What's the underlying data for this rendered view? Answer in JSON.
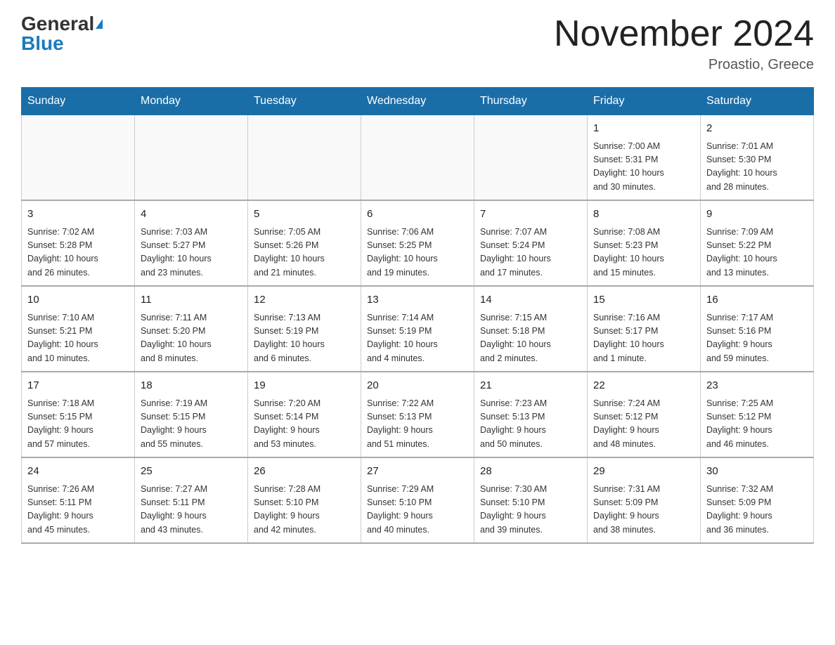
{
  "header": {
    "logo_general": "General",
    "logo_blue": "Blue",
    "month_title": "November 2024",
    "location": "Proastio, Greece"
  },
  "weekdays": [
    "Sunday",
    "Monday",
    "Tuesday",
    "Wednesday",
    "Thursday",
    "Friday",
    "Saturday"
  ],
  "weeks": [
    [
      {
        "day": "",
        "info": ""
      },
      {
        "day": "",
        "info": ""
      },
      {
        "day": "",
        "info": ""
      },
      {
        "day": "",
        "info": ""
      },
      {
        "day": "",
        "info": ""
      },
      {
        "day": "1",
        "info": "Sunrise: 7:00 AM\nSunset: 5:31 PM\nDaylight: 10 hours\nand 30 minutes."
      },
      {
        "day": "2",
        "info": "Sunrise: 7:01 AM\nSunset: 5:30 PM\nDaylight: 10 hours\nand 28 minutes."
      }
    ],
    [
      {
        "day": "3",
        "info": "Sunrise: 7:02 AM\nSunset: 5:28 PM\nDaylight: 10 hours\nand 26 minutes."
      },
      {
        "day": "4",
        "info": "Sunrise: 7:03 AM\nSunset: 5:27 PM\nDaylight: 10 hours\nand 23 minutes."
      },
      {
        "day": "5",
        "info": "Sunrise: 7:05 AM\nSunset: 5:26 PM\nDaylight: 10 hours\nand 21 minutes."
      },
      {
        "day": "6",
        "info": "Sunrise: 7:06 AM\nSunset: 5:25 PM\nDaylight: 10 hours\nand 19 minutes."
      },
      {
        "day": "7",
        "info": "Sunrise: 7:07 AM\nSunset: 5:24 PM\nDaylight: 10 hours\nand 17 minutes."
      },
      {
        "day": "8",
        "info": "Sunrise: 7:08 AM\nSunset: 5:23 PM\nDaylight: 10 hours\nand 15 minutes."
      },
      {
        "day": "9",
        "info": "Sunrise: 7:09 AM\nSunset: 5:22 PM\nDaylight: 10 hours\nand 13 minutes."
      }
    ],
    [
      {
        "day": "10",
        "info": "Sunrise: 7:10 AM\nSunset: 5:21 PM\nDaylight: 10 hours\nand 10 minutes."
      },
      {
        "day": "11",
        "info": "Sunrise: 7:11 AM\nSunset: 5:20 PM\nDaylight: 10 hours\nand 8 minutes."
      },
      {
        "day": "12",
        "info": "Sunrise: 7:13 AM\nSunset: 5:19 PM\nDaylight: 10 hours\nand 6 minutes."
      },
      {
        "day": "13",
        "info": "Sunrise: 7:14 AM\nSunset: 5:19 PM\nDaylight: 10 hours\nand 4 minutes."
      },
      {
        "day": "14",
        "info": "Sunrise: 7:15 AM\nSunset: 5:18 PM\nDaylight: 10 hours\nand 2 minutes."
      },
      {
        "day": "15",
        "info": "Sunrise: 7:16 AM\nSunset: 5:17 PM\nDaylight: 10 hours\nand 1 minute."
      },
      {
        "day": "16",
        "info": "Sunrise: 7:17 AM\nSunset: 5:16 PM\nDaylight: 9 hours\nand 59 minutes."
      }
    ],
    [
      {
        "day": "17",
        "info": "Sunrise: 7:18 AM\nSunset: 5:15 PM\nDaylight: 9 hours\nand 57 minutes."
      },
      {
        "day": "18",
        "info": "Sunrise: 7:19 AM\nSunset: 5:15 PM\nDaylight: 9 hours\nand 55 minutes."
      },
      {
        "day": "19",
        "info": "Sunrise: 7:20 AM\nSunset: 5:14 PM\nDaylight: 9 hours\nand 53 minutes."
      },
      {
        "day": "20",
        "info": "Sunrise: 7:22 AM\nSunset: 5:13 PM\nDaylight: 9 hours\nand 51 minutes."
      },
      {
        "day": "21",
        "info": "Sunrise: 7:23 AM\nSunset: 5:13 PM\nDaylight: 9 hours\nand 50 minutes."
      },
      {
        "day": "22",
        "info": "Sunrise: 7:24 AM\nSunset: 5:12 PM\nDaylight: 9 hours\nand 48 minutes."
      },
      {
        "day": "23",
        "info": "Sunrise: 7:25 AM\nSunset: 5:12 PM\nDaylight: 9 hours\nand 46 minutes."
      }
    ],
    [
      {
        "day": "24",
        "info": "Sunrise: 7:26 AM\nSunset: 5:11 PM\nDaylight: 9 hours\nand 45 minutes."
      },
      {
        "day": "25",
        "info": "Sunrise: 7:27 AM\nSunset: 5:11 PM\nDaylight: 9 hours\nand 43 minutes."
      },
      {
        "day": "26",
        "info": "Sunrise: 7:28 AM\nSunset: 5:10 PM\nDaylight: 9 hours\nand 42 minutes."
      },
      {
        "day": "27",
        "info": "Sunrise: 7:29 AM\nSunset: 5:10 PM\nDaylight: 9 hours\nand 40 minutes."
      },
      {
        "day": "28",
        "info": "Sunrise: 7:30 AM\nSunset: 5:10 PM\nDaylight: 9 hours\nand 39 minutes."
      },
      {
        "day": "29",
        "info": "Sunrise: 7:31 AM\nSunset: 5:09 PM\nDaylight: 9 hours\nand 38 minutes."
      },
      {
        "day": "30",
        "info": "Sunrise: 7:32 AM\nSunset: 5:09 PM\nDaylight: 9 hours\nand 36 minutes."
      }
    ]
  ]
}
